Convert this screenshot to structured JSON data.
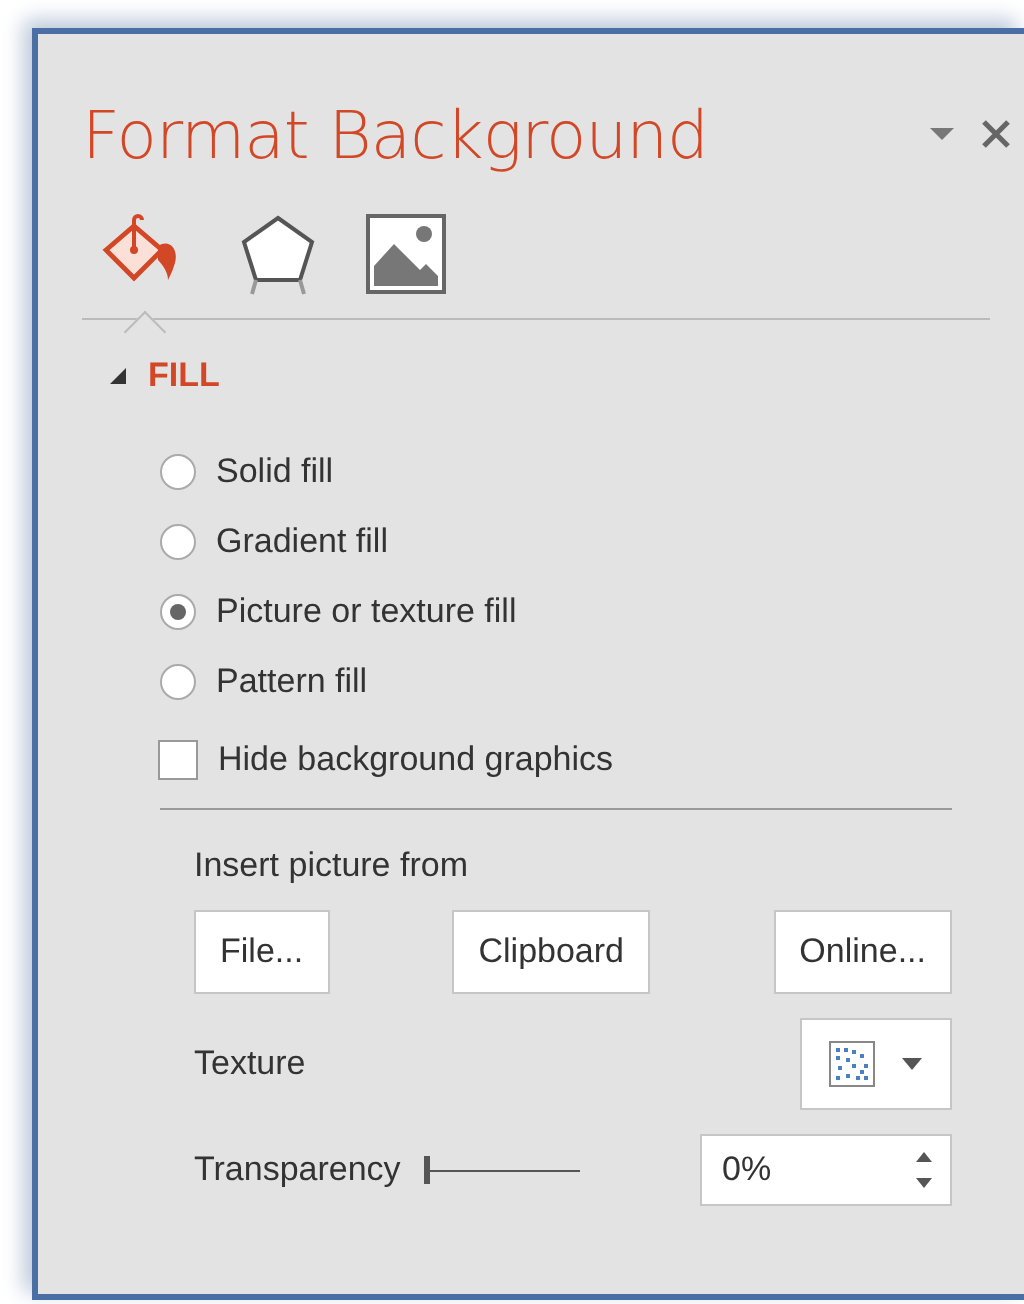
{
  "pane": {
    "title": "Format Background"
  },
  "tabs": [
    {
      "kind": "fill",
      "selected": true
    },
    {
      "kind": "effects",
      "selected": false
    },
    {
      "kind": "picture",
      "selected": false
    }
  ],
  "section": {
    "title": "FILL",
    "expanded": true
  },
  "fill_options": [
    {
      "label": "Solid fill",
      "selected": false
    },
    {
      "label": "Gradient fill",
      "selected": false
    },
    {
      "label": "Picture or texture fill",
      "selected": true
    },
    {
      "label": "Pattern fill",
      "selected": false
    }
  ],
  "hide_graphics": {
    "label": "Hide background graphics",
    "checked": false
  },
  "insert_label": "Insert picture from",
  "insert_buttons": [
    {
      "label": "File..."
    },
    {
      "label": "Clipboard"
    },
    {
      "label": "Online..."
    }
  ],
  "texture": {
    "label": "Texture"
  },
  "transparency": {
    "label": "Transparency",
    "level": 0,
    "value": "0%"
  }
}
